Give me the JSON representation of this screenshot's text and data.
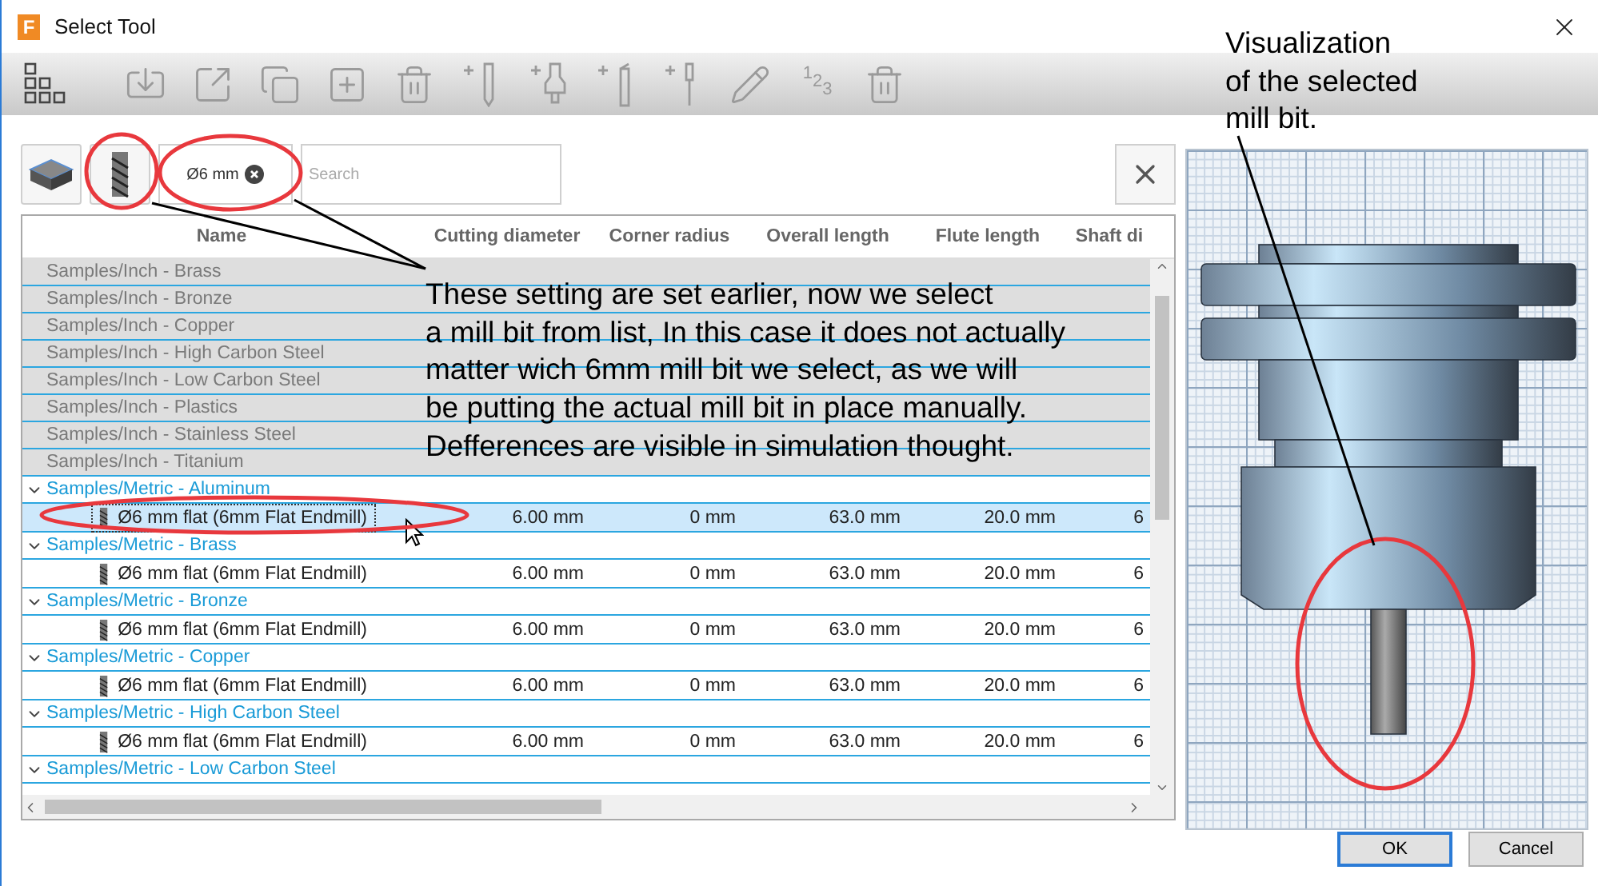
{
  "window": {
    "title": "Select Tool",
    "app_icon_letter": "F"
  },
  "toolbar": [
    {
      "kind": "library",
      "disabled": false
    },
    {
      "kind": "import",
      "disabled": true
    },
    {
      "kind": "export",
      "disabled": true
    },
    {
      "kind": "duplicate",
      "disabled": true
    },
    {
      "kind": "new",
      "disabled": true
    },
    {
      "kind": "delete",
      "disabled": true
    },
    {
      "kind": "add-mill",
      "disabled": true
    },
    {
      "kind": "add-holder",
      "disabled": true
    },
    {
      "kind": "add-turning",
      "disabled": true
    },
    {
      "kind": "add-probe",
      "disabled": true
    },
    {
      "kind": "edit",
      "disabled": true
    },
    {
      "kind": "renumber",
      "disabled": true,
      "label": "123"
    },
    {
      "kind": "delete",
      "disabled": true
    }
  ],
  "filters": {
    "buttons": [
      {
        "kind": "stock"
      },
      {
        "kind": "mill"
      }
    ],
    "chip": {
      "label": "Ø6 mm"
    },
    "search": {
      "placeholder": "Search"
    }
  },
  "table": {
    "columns": [
      "Name",
      "Cutting diameter",
      "Corner radius",
      "Overall length",
      "Flute length",
      "Shaft di"
    ],
    "groups": [
      {
        "name": "Samples/Inch - Brass",
        "dimmed": true,
        "expanded": false
      },
      {
        "name": "Samples/Inch - Bronze",
        "dimmed": true,
        "expanded": false
      },
      {
        "name": "Samples/Inch - Copper",
        "dimmed": true,
        "expanded": false
      },
      {
        "name": "Samples/Inch - High Carbon Steel",
        "dimmed": true,
        "expanded": false
      },
      {
        "name": "Samples/Inch - Low Carbon Steel",
        "dimmed": true,
        "expanded": false
      },
      {
        "name": "Samples/Inch - Plastics",
        "dimmed": true,
        "expanded": false
      },
      {
        "name": "Samples/Inch - Stainless Steel",
        "dimmed": true,
        "expanded": false
      },
      {
        "name": "Samples/Inch - Titanium",
        "dimmed": true,
        "expanded": false
      },
      {
        "name": "Samples/Metric - Aluminum",
        "dimmed": false,
        "expanded": true,
        "tools": [
          {
            "selected": true,
            "cells": [
              "Ø6 mm flat (6mm Flat Endmill)",
              "6.00 mm",
              "0 mm",
              "63.0 mm",
              "20.0 mm",
              "6"
            ]
          }
        ]
      },
      {
        "name": "Samples/Metric - Brass",
        "dimmed": false,
        "expanded": true,
        "tools": [
          {
            "selected": false,
            "cells": [
              "Ø6 mm flat (6mm Flat Endmill)",
              "6.00 mm",
              "0 mm",
              "63.0 mm",
              "20.0 mm",
              "6"
            ]
          }
        ]
      },
      {
        "name": "Samples/Metric - Bronze",
        "dimmed": false,
        "expanded": true,
        "tools": [
          {
            "selected": false,
            "cells": [
              "Ø6 mm flat (6mm Flat Endmill)",
              "6.00 mm",
              "0 mm",
              "63.0 mm",
              "20.0 mm",
              "6"
            ]
          }
        ]
      },
      {
        "name": "Samples/Metric - Copper",
        "dimmed": false,
        "expanded": true,
        "tools": [
          {
            "selected": false,
            "cells": [
              "Ø6 mm flat (6mm Flat Endmill)",
              "6.00 mm",
              "0 mm",
              "63.0 mm",
              "20.0 mm",
              "6"
            ]
          }
        ]
      },
      {
        "name": "Samples/Metric - High Carbon Steel",
        "dimmed": false,
        "expanded": true,
        "tools": [
          {
            "selected": false,
            "cells": [
              "Ø6 mm flat (6mm Flat Endmill)",
              "6.00 mm",
              "0 mm",
              "63.0 mm",
              "20.0 mm",
              "6"
            ]
          }
        ]
      },
      {
        "name": "Samples/Metric - Low Carbon Steel",
        "dimmed": false,
        "expanded": true
      }
    ]
  },
  "footer": {
    "buttons": [
      {
        "label": "OK",
        "default": true
      },
      {
        "label": "Cancel",
        "default": false
      }
    ]
  },
  "annotations": {
    "callouts": [
      {
        "lines": [
          "These setting are set earlier, now we select",
          "a mill bit from list, In this case it does not actually",
          "matter wich 6mm mill bit we select, as we will",
          "be putting the actual mill bit in place manually.",
          "Defferences are visible in simulation thought."
        ]
      },
      {
        "lines": [
          "Visualization",
          "of the selected",
          "mill bit."
        ]
      }
    ]
  }
}
